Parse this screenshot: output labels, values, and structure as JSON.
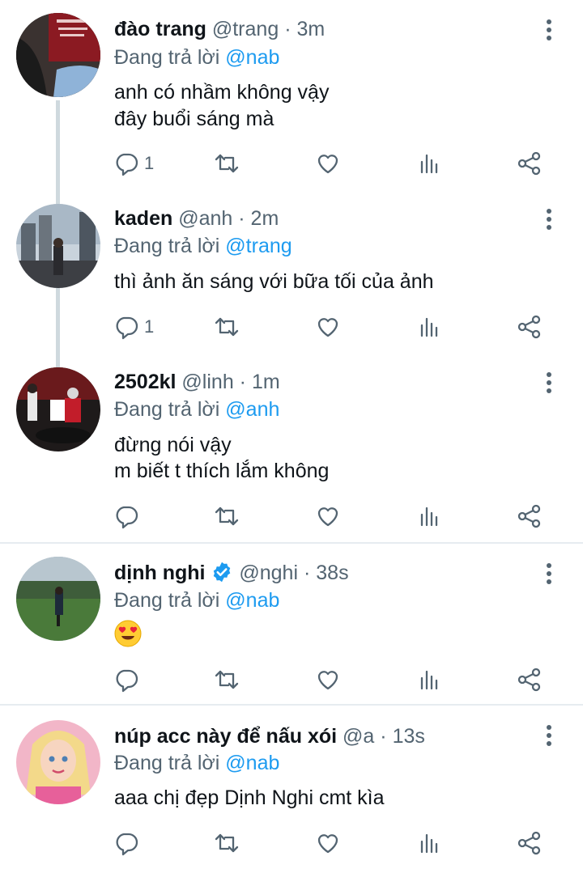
{
  "reply_prefix": "Đang trả lời",
  "tweets": [
    {
      "name": "đào trang",
      "handle": "@trang",
      "time": "3m",
      "reply_to": "@nab",
      "lines": [
        "anh có nhầm không vậy",
        "đây buổi sáng mà"
      ],
      "reply_count": "1"
    },
    {
      "name": "kaden",
      "handle": "@anh",
      "time": "2m",
      "reply_to": "@trang",
      "lines": [
        "thì ảnh ăn sáng với bữa tối của ảnh"
      ],
      "reply_count": "1"
    },
    {
      "name": "2502kl",
      "handle": "@linh",
      "time": "1m",
      "reply_to": "@anh",
      "lines": [
        "đừng nói vậy",
        "m biết t thích lắm không"
      ],
      "reply_count": ""
    },
    {
      "name": "dịnh nghi",
      "handle": "@nghi",
      "time": "38s",
      "reply_to": "@nab",
      "verified": true,
      "emoji": "heart-eyes-emoji",
      "reply_count": ""
    },
    {
      "name": "núp acc này để nấu xói",
      "handle": "@a",
      "time": "13s",
      "reply_to": "@nab",
      "lines": [
        "aaa chị đẹp Dịnh Nghi cmt kìa"
      ],
      "reply_count": ""
    }
  ],
  "icons": {
    "reply": "reply-icon",
    "retweet": "retweet-icon",
    "like": "heart-icon",
    "analytics": "analytics-icon",
    "share": "share-icon",
    "more": "more-vertical-icon",
    "verified": "verified-badge-icon"
  },
  "colors": {
    "link": "#1d9bf0",
    "secondary_text": "#536471",
    "divider": "#e6ecf0",
    "thread_line": "#cfd9de"
  }
}
